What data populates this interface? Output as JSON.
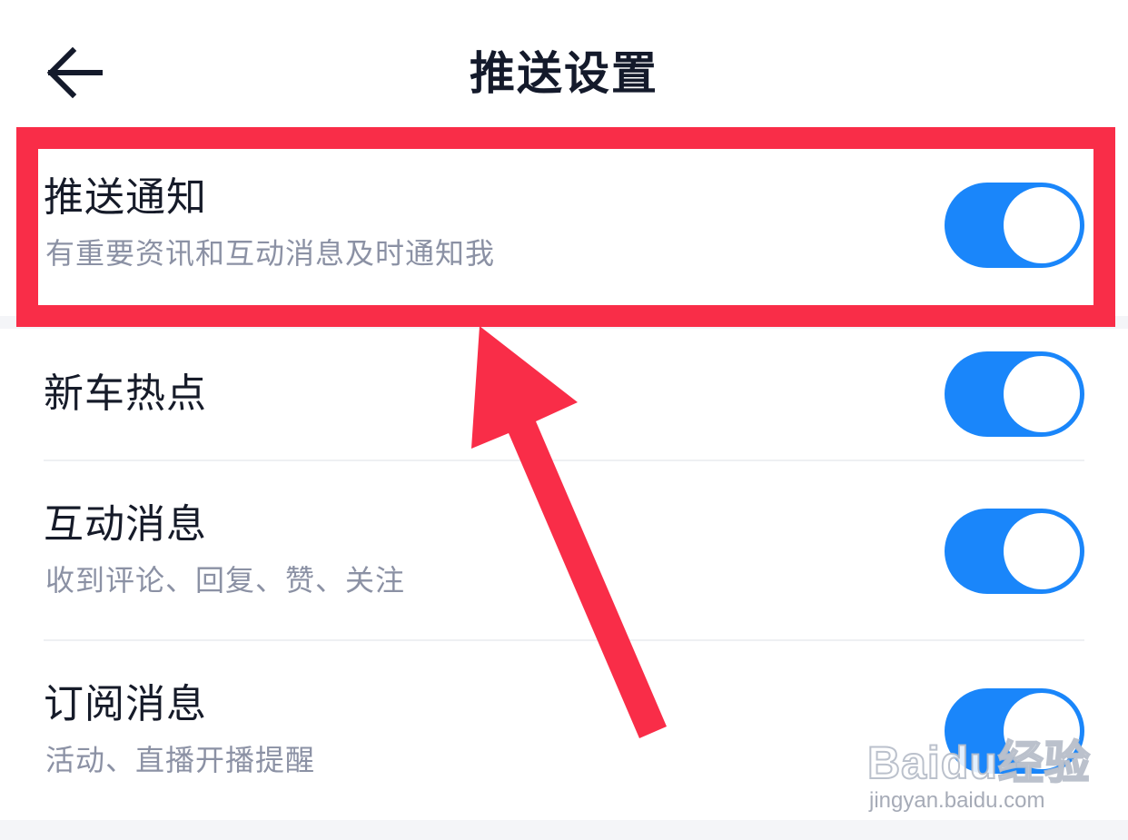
{
  "header": {
    "title": "推送设置",
    "back_icon": "arrow-left-icon"
  },
  "settings": [
    {
      "title": "推送通知",
      "subtitle": "有重要资讯和互动消息及时通知我",
      "enabled": true
    },
    {
      "title": "新车热点",
      "subtitle": "",
      "enabled": true
    },
    {
      "title": "互动消息",
      "subtitle": "收到评论、回复、赞、关注",
      "enabled": true
    },
    {
      "title": "订阅消息",
      "subtitle": "活动、直播开播提醒",
      "enabled": true
    }
  ],
  "annotation": {
    "highlight_color": "#f92d48",
    "arrow_color": "#f92d48"
  },
  "watermark": {
    "logo_text": "Baidu经验",
    "url": "jingyan.baidu.com"
  },
  "colors": {
    "toggle_on": "#1a86fa",
    "title_text": "#161b29",
    "subtitle_text": "#8b91a4"
  }
}
